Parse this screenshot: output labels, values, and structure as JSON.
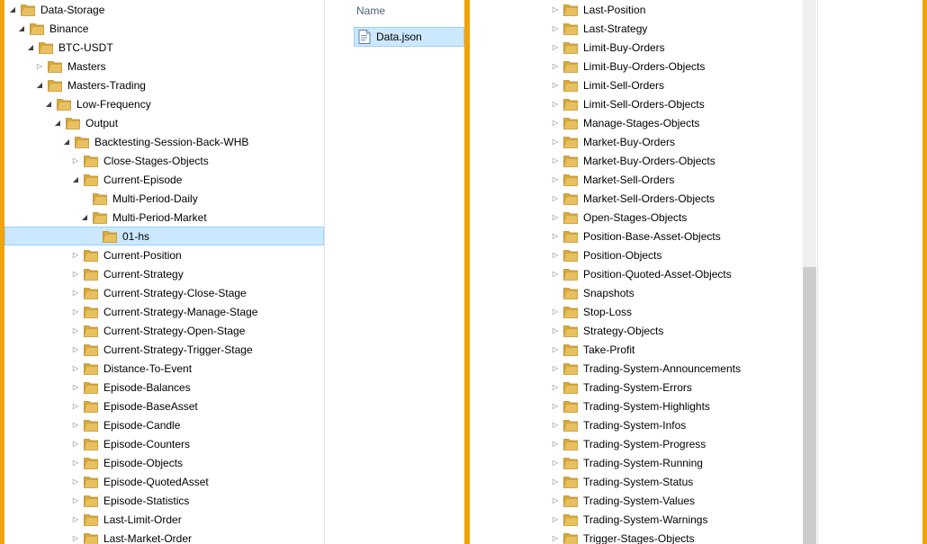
{
  "colors": {
    "accent": "#f0a30a",
    "selection": "#cce8ff",
    "selection_border": "#99d1ff",
    "folder": "#e8c060"
  },
  "file_list": {
    "column_name": "Name",
    "files": [
      {
        "name": "Data.json",
        "icon": "json-file-icon"
      }
    ]
  },
  "left_tree": [
    {
      "label": "Data-Storage",
      "level": 0,
      "arrow": "expanded"
    },
    {
      "label": "Binance",
      "level": 1,
      "arrow": "expanded"
    },
    {
      "label": "BTC-USDT",
      "level": 2,
      "arrow": "expanded"
    },
    {
      "label": "Masters",
      "level": 3,
      "arrow": "collapsed"
    },
    {
      "label": "Masters-Trading",
      "level": 3,
      "arrow": "expanded"
    },
    {
      "label": "Low-Frequency",
      "level": 4,
      "arrow": "expanded"
    },
    {
      "label": "Output",
      "level": 5,
      "arrow": "expanded"
    },
    {
      "label": "Backtesting-Session-Back-WHB",
      "level": 6,
      "arrow": "expanded"
    },
    {
      "label": "Close-Stages-Objects",
      "level": 7,
      "arrow": "collapsed"
    },
    {
      "label": "Current-Episode",
      "level": 7,
      "arrow": "expanded"
    },
    {
      "label": "Multi-Period-Daily",
      "level": 8,
      "arrow": "none"
    },
    {
      "label": "Multi-Period-Market",
      "level": 8,
      "arrow": "expanded"
    },
    {
      "label": "01-hs",
      "level": 9,
      "arrow": "none",
      "selected": true
    },
    {
      "label": "Current-Position",
      "level": 7,
      "arrow": "collapsed"
    },
    {
      "label": "Current-Strategy",
      "level": 7,
      "arrow": "collapsed"
    },
    {
      "label": "Current-Strategy-Close-Stage",
      "level": 7,
      "arrow": "collapsed"
    },
    {
      "label": "Current-Strategy-Manage-Stage",
      "level": 7,
      "arrow": "collapsed"
    },
    {
      "label": "Current-Strategy-Open-Stage",
      "level": 7,
      "arrow": "collapsed"
    },
    {
      "label": "Current-Strategy-Trigger-Stage",
      "level": 7,
      "arrow": "collapsed"
    },
    {
      "label": "Distance-To-Event",
      "level": 7,
      "arrow": "collapsed"
    },
    {
      "label": "Episode-Balances",
      "level": 7,
      "arrow": "collapsed"
    },
    {
      "label": "Episode-BaseAsset",
      "level": 7,
      "arrow": "collapsed"
    },
    {
      "label": "Episode-Candle",
      "level": 7,
      "arrow": "collapsed"
    },
    {
      "label": "Episode-Counters",
      "level": 7,
      "arrow": "collapsed"
    },
    {
      "label": "Episode-Objects",
      "level": 7,
      "arrow": "collapsed"
    },
    {
      "label": "Episode-QuotedAsset",
      "level": 7,
      "arrow": "collapsed"
    },
    {
      "label": "Episode-Statistics",
      "level": 7,
      "arrow": "collapsed"
    },
    {
      "label": "Last-Limit-Order",
      "level": 7,
      "arrow": "collapsed"
    },
    {
      "label": "Last-Market-Order",
      "level": 7,
      "arrow": "collapsed"
    }
  ],
  "right_tree": [
    {
      "label": "Last-Position",
      "arrow": "collapsed"
    },
    {
      "label": "Last-Strategy",
      "arrow": "collapsed"
    },
    {
      "label": "Limit-Buy-Orders",
      "arrow": "collapsed"
    },
    {
      "label": "Limit-Buy-Orders-Objects",
      "arrow": "collapsed"
    },
    {
      "label": "Limit-Sell-Orders",
      "arrow": "collapsed"
    },
    {
      "label": "Limit-Sell-Orders-Objects",
      "arrow": "collapsed"
    },
    {
      "label": "Manage-Stages-Objects",
      "arrow": "collapsed"
    },
    {
      "label": "Market-Buy-Orders",
      "arrow": "collapsed"
    },
    {
      "label": "Market-Buy-Orders-Objects",
      "arrow": "collapsed"
    },
    {
      "label": "Market-Sell-Orders",
      "arrow": "collapsed"
    },
    {
      "label": "Market-Sell-Orders-Objects",
      "arrow": "collapsed"
    },
    {
      "label": "Open-Stages-Objects",
      "arrow": "collapsed"
    },
    {
      "label": "Position-Base-Asset-Objects",
      "arrow": "collapsed"
    },
    {
      "label": "Position-Objects",
      "arrow": "collapsed"
    },
    {
      "label": "Position-Quoted-Asset-Objects",
      "arrow": "collapsed"
    },
    {
      "label": "Snapshots",
      "arrow": "none"
    },
    {
      "label": "Stop-Loss",
      "arrow": "collapsed"
    },
    {
      "label": "Strategy-Objects",
      "arrow": "collapsed"
    },
    {
      "label": "Take-Profit",
      "arrow": "collapsed"
    },
    {
      "label": "Trading-System-Announcements",
      "arrow": "collapsed"
    },
    {
      "label": "Trading-System-Errors",
      "arrow": "collapsed"
    },
    {
      "label": "Trading-System-Highlights",
      "arrow": "collapsed"
    },
    {
      "label": "Trading-System-Infos",
      "arrow": "collapsed"
    },
    {
      "label": "Trading-System-Progress",
      "arrow": "collapsed"
    },
    {
      "label": "Trading-System-Running",
      "arrow": "collapsed"
    },
    {
      "label": "Trading-System-Status",
      "arrow": "collapsed"
    },
    {
      "label": "Trading-System-Values",
      "arrow": "collapsed"
    },
    {
      "label": "Trading-System-Warnings",
      "arrow": "collapsed"
    },
    {
      "label": "Trigger-Stages-Objects",
      "arrow": "collapsed"
    }
  ]
}
